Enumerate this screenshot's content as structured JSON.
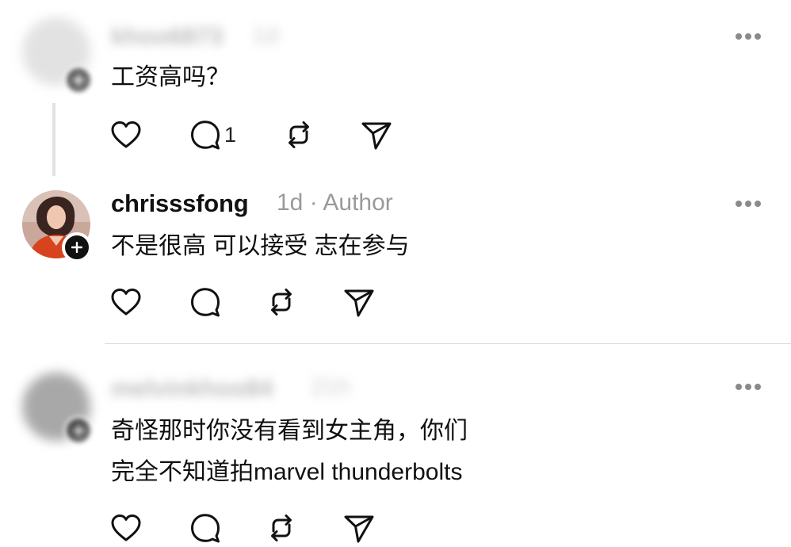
{
  "posts": [
    {
      "username": "khoo6873",
      "time": "1d",
      "text_lines": [
        "工资高吗？"
      ],
      "reply_count": "1"
    },
    {
      "username": "chrisssfong",
      "meta": "1d · Author",
      "text_lines": [
        "不是很高 可以接受 志在参与"
      ]
    },
    {
      "username": "melvinkhoo84",
      "time": "21h",
      "text_lines": [
        "奇怪那时你没有看到女主角，你们",
        "完全不知道拍marvel thunderbolts"
      ]
    }
  ],
  "icons": {
    "like": "heart-icon",
    "reply": "comment-icon",
    "repost": "repost-icon",
    "share": "send-icon",
    "more": "more-dots-icon",
    "follow": "plus-icon"
  },
  "colors": {
    "text": "#101010",
    "meta": "#9a9a9a",
    "divider": "#dcdcdc"
  }
}
